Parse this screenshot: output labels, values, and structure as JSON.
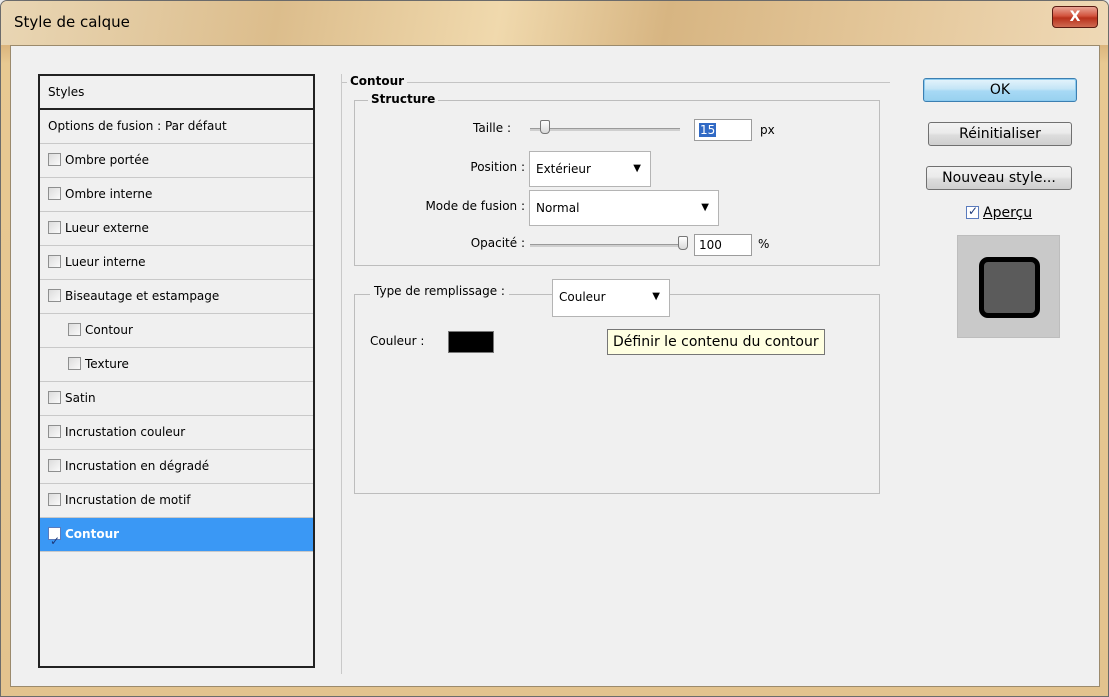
{
  "window": {
    "title": "Style de calque",
    "close_glyph": "X"
  },
  "styles": {
    "header": "Styles",
    "fusion": "Options de fusion : Par défaut",
    "items": [
      {
        "label": "Ombre portée",
        "checked": false
      },
      {
        "label": "Ombre interne",
        "checked": false
      },
      {
        "label": "Lueur externe",
        "checked": false
      },
      {
        "label": "Lueur interne",
        "checked": false
      },
      {
        "label": "Biseautage et estampage",
        "checked": false
      },
      {
        "label": "Contour",
        "checked": false
      },
      {
        "label": "Texture",
        "checked": false
      },
      {
        "label": "Satin",
        "checked": false
      },
      {
        "label": "Incrustation couleur",
        "checked": false
      },
      {
        "label": "Incrustation en dégradé",
        "checked": false
      },
      {
        "label": "Incrustation de motif",
        "checked": false
      },
      {
        "label": "Contour",
        "checked": true
      }
    ]
  },
  "contour": {
    "title": "Contour",
    "structure": {
      "title": "Structure",
      "taille_label": "Taille :",
      "taille_value": "15",
      "taille_unit": "px",
      "position_label": "Position :",
      "position_value": "Extérieur",
      "mode_label": "Mode de fusion :",
      "mode_value": "Normal",
      "opacite_label": "Opacité :",
      "opacite_value": "100",
      "opacite_unit": "%"
    },
    "fill": {
      "type_label": "Type de remplissage :",
      "type_value": "Couleur",
      "couleur_label": "Couleur :",
      "couleur_hex": "#000000",
      "tooltip": "Définir le contenu du contour"
    }
  },
  "buttons": {
    "ok": "OK",
    "reset": "Réinitialiser",
    "new_style": "Nouveau style...",
    "preview_label": "Aperçu",
    "preview_checked": true
  },
  "colors": {
    "selection": "#3a98f5",
    "tooltip_bg": "#ffffe1"
  }
}
